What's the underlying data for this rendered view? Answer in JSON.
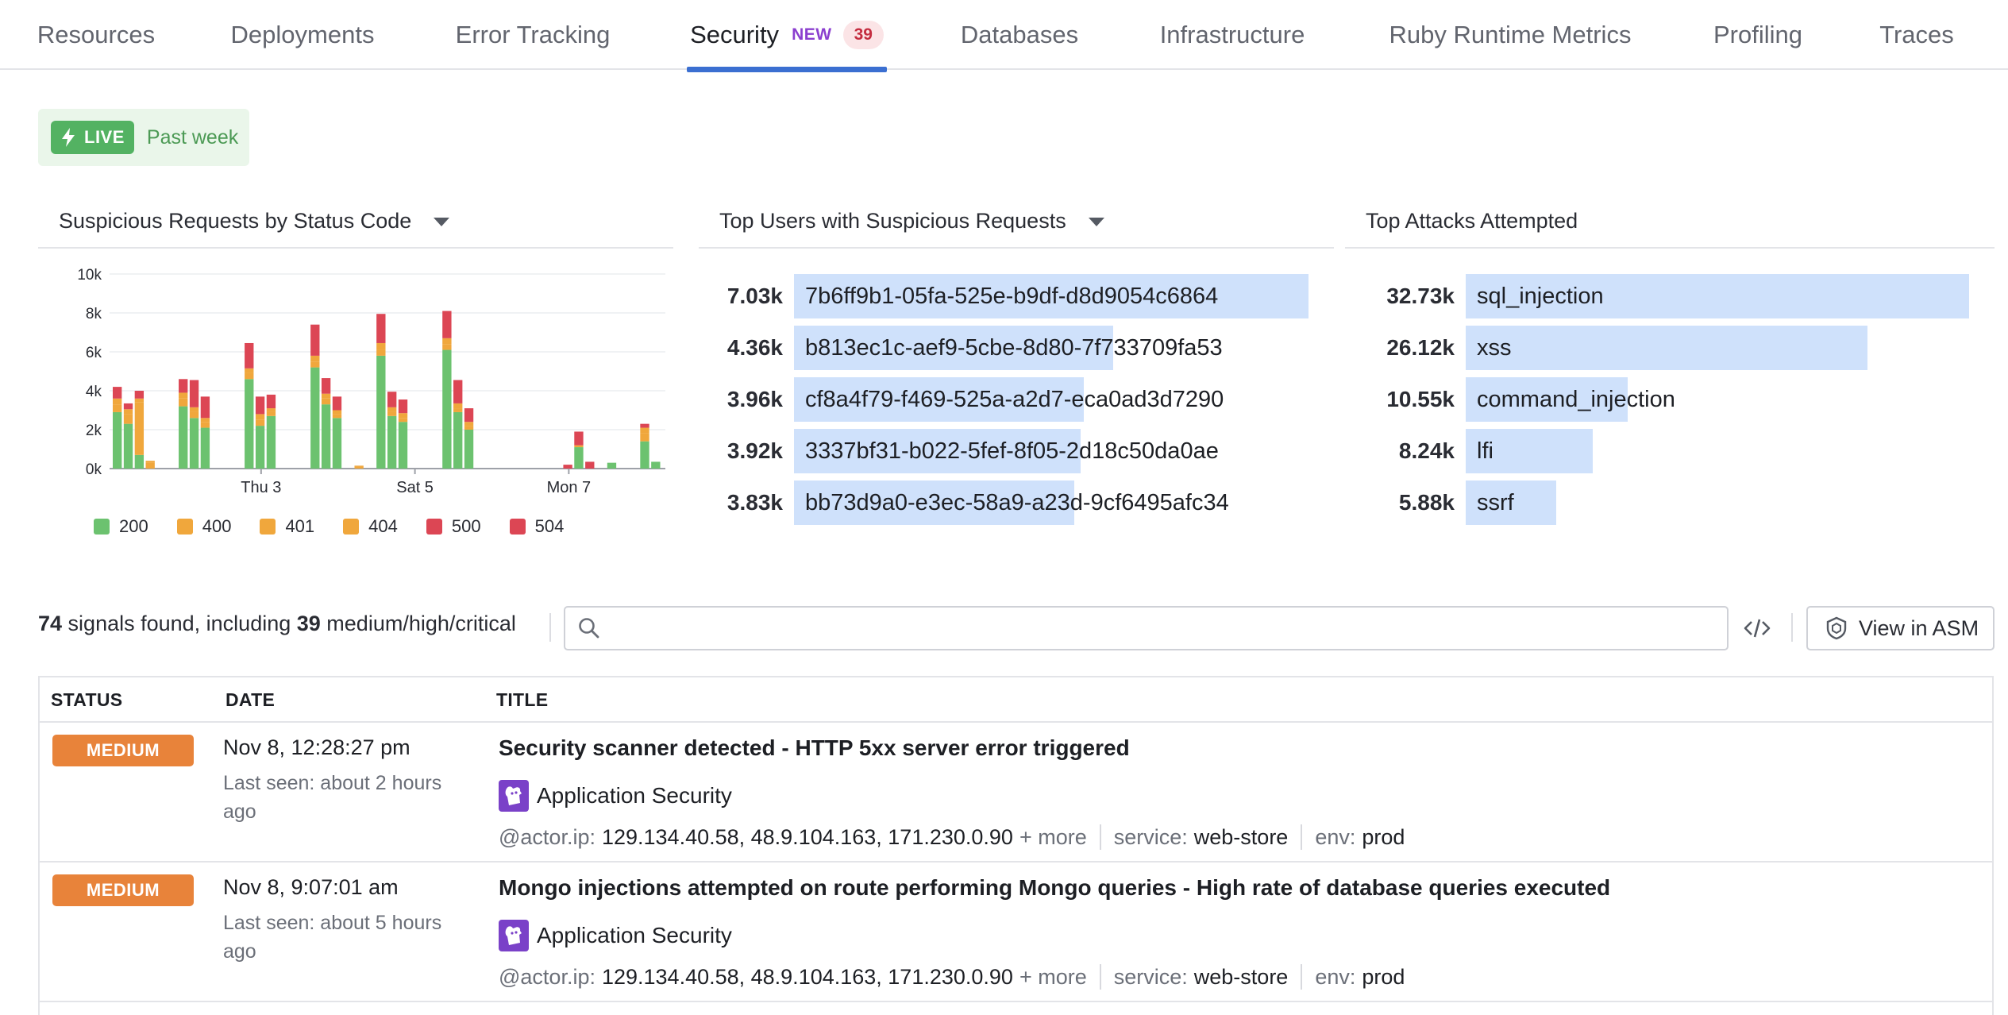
{
  "tabs": [
    {
      "label": "Resources"
    },
    {
      "label": "Deployments"
    },
    {
      "label": "Error Tracking"
    },
    {
      "label": "Security",
      "new_badge": "NEW",
      "count": "39",
      "active": true
    },
    {
      "label": "Databases"
    },
    {
      "label": "Infrastructure"
    },
    {
      "label": "Ruby Runtime Metrics"
    },
    {
      "label": "Profiling"
    },
    {
      "label": "Traces"
    }
  ],
  "live": {
    "badge": "LIVE",
    "range": "Past week"
  },
  "widgets": {
    "status_chart": {
      "title": "Suspicious Requests by Status Code"
    },
    "top_users": {
      "title": "Top Users with Suspicious Requests"
    },
    "top_attacks": {
      "title": "Top Attacks Attempted"
    }
  },
  "chart_data": [
    {
      "type": "bar",
      "stacked": true,
      "title": "Suspicious Requests by Status Code",
      "x_tick_labels": [
        "Thu 3",
        "Sat 5",
        "Mon 7"
      ],
      "y_tick_labels": [
        "0k",
        "2k",
        "4k",
        "6k",
        "8k",
        "10k"
      ],
      "ylim": [
        0,
        10000
      ],
      "grid": true,
      "legend": "bottom",
      "colors": {
        "200": "#6cc26f",
        "400": "#f0a73c",
        "401": "#f0a73c",
        "404": "#f0a73c",
        "500": "#dc4654",
        "504": "#dc4654"
      },
      "series": [
        {
          "name": "200",
          "values": [
            2900,
            2300,
            700,
            0,
            0,
            0,
            3200,
            2600,
            2100,
            0,
            0,
            0,
            4600,
            2200,
            2700,
            0,
            0,
            0,
            5200,
            3300,
            2600,
            0,
            0,
            0,
            5800,
            2700,
            2400,
            0,
            0,
            0,
            6100,
            2900,
            2000,
            0,
            0,
            0,
            0,
            0,
            0,
            0,
            0,
            0,
            1100,
            0,
            0,
            300,
            0,
            0,
            1400,
            350
          ]
        },
        {
          "name": "400",
          "values": [
            400,
            500,
            2700,
            300,
            0,
            0,
            400,
            300,
            300,
            0,
            0,
            0,
            300,
            300,
            200,
            0,
            0,
            0,
            300,
            300,
            200,
            0,
            100,
            0,
            300,
            200,
            200,
            0,
            0,
            0,
            300,
            200,
            200,
            0,
            0,
            0,
            0,
            0,
            0,
            0,
            0,
            0,
            0,
            0,
            0,
            0,
            0,
            0,
            400,
            0
          ]
        },
        {
          "name": "401",
          "values": [
            0,
            0,
            0,
            0,
            0,
            0,
            0,
            0,
            0,
            0,
            0,
            0,
            0,
            0,
            0,
            0,
            0,
            0,
            0,
            0,
            0,
            0,
            0,
            0,
            0,
            0,
            0,
            0,
            0,
            0,
            0,
            0,
            0,
            0,
            0,
            0,
            0,
            0,
            0,
            0,
            0,
            0,
            0,
            0,
            0,
            0,
            0,
            0,
            0,
            0
          ]
        },
        {
          "name": "404",
          "values": [
            300,
            250,
            200,
            100,
            0,
            0,
            300,
            250,
            200,
            0,
            0,
            0,
            250,
            300,
            200,
            0,
            0,
            0,
            300,
            250,
            200,
            0,
            50,
            0,
            350,
            250,
            250,
            0,
            0,
            0,
            300,
            250,
            200,
            0,
            0,
            0,
            0,
            0,
            0,
            0,
            0,
            0,
            100,
            0,
            0,
            0,
            0,
            0,
            300,
            0
          ]
        },
        {
          "name": "500",
          "values": [
            0,
            0,
            0,
            0,
            0,
            0,
            0,
            0,
            0,
            0,
            0,
            0,
            0,
            0,
            0,
            0,
            0,
            0,
            0,
            0,
            0,
            0,
            0,
            0,
            0,
            0,
            0,
            0,
            0,
            0,
            0,
            0,
            0,
            0,
            0,
            0,
            0,
            0,
            0,
            0,
            0,
            0,
            0,
            0,
            0,
            0,
            0,
            0,
            0,
            0
          ]
        },
        {
          "name": "504",
          "values": [
            600,
            300,
            400,
            0,
            0,
            0,
            700,
            1400,
            1100,
            0,
            0,
            0,
            1300,
            900,
            700,
            0,
            0,
            0,
            1600,
            800,
            700,
            0,
            0,
            0,
            1500,
            800,
            700,
            0,
            0,
            0,
            1400,
            1200,
            700,
            0,
            0,
            0,
            0,
            0,
            0,
            0,
            0,
            200,
            700,
            350,
            0,
            0,
            0,
            0,
            200,
            0
          ]
        }
      ]
    },
    {
      "type": "bar",
      "orientation": "horizontal",
      "title": "Top Users with Suspicious Requests",
      "categories": [
        "7b6ff9b1-05fa-525e-b9df-d8d9054c6864",
        "b813ec1c-aef9-5cbe-8d80-7f733709fa53",
        "cf8a4f79-f469-525a-a2d7-eca0ad3d7290",
        "3337bf31-b022-5fef-8f05-2d18c50da0ae",
        "bb73d9a0-e3ec-58a9-a23d-9cf6495afc34"
      ],
      "values": [
        7030,
        4360,
        3960,
        3920,
        3830
      ],
      "value_labels": [
        "7.03k",
        "4.36k",
        "3.96k",
        "3.92k",
        "3.83k"
      ]
    },
    {
      "type": "bar",
      "orientation": "horizontal",
      "title": "Top Attacks Attempted",
      "categories": [
        "sql_injection",
        "xss",
        "command_injection",
        "lfi",
        "ssrf"
      ],
      "values": [
        32730,
        26120,
        10550,
        8240,
        5880
      ],
      "value_labels": [
        "32.73k",
        "26.12k",
        "10.55k",
        "8.24k",
        "5.88k"
      ]
    }
  ],
  "signals": {
    "count": "74",
    "text_mid": " signals found, including ",
    "severe_count": "39",
    "text_end": " medium/high/critical",
    "search_placeholder": "",
    "view_button": "View in ASM",
    "code_icon": "code-icon"
  },
  "table": {
    "headers": {
      "status": "STATUS",
      "date": "DATE",
      "title": "TITLE"
    },
    "rows": [
      {
        "severity": "MEDIUM",
        "date": "Nov 8, 12:28:27 pm",
        "last_seen": "Last seen: about 2 hours ago",
        "title": "Security scanner detected - HTTP 5xx server error triggered",
        "source": "Application Security",
        "actor_ip_key": "@actor.ip:",
        "actor_ip_val": "129.134.40.58, 48.9.104.163, 171.230.0.90",
        "more": "+ more",
        "service_key": "service:",
        "service_val": "web-store",
        "env_key": "env:",
        "env_val": "prod"
      },
      {
        "severity": "MEDIUM",
        "date": "Nov 8, 9:07:01 am",
        "last_seen": "Last seen: about 5 hours ago",
        "title": "Mongo injections attempted on route performing Mongo queries - High rate of database queries executed",
        "source": "Application Security",
        "actor_ip_key": "@actor.ip:",
        "actor_ip_val": "129.134.40.58, 48.9.104.163, 171.230.0.90",
        "more": "+ more",
        "service_key": "service:",
        "service_val": "web-store",
        "env_key": "env:",
        "env_val": "prod"
      }
    ]
  },
  "colors": {
    "accent": "#3b6fd1",
    "live_green": "#53b262",
    "medium": "#e8833a",
    "bar_blue": "#cfe1fb"
  }
}
